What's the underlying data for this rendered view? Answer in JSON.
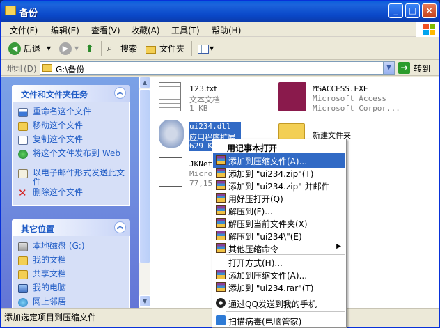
{
  "window": {
    "title": "备份"
  },
  "menu": [
    "文件(F)",
    "编辑(E)",
    "查看(V)",
    "收藏(A)",
    "工具(T)",
    "帮助(H)"
  ],
  "toolbar": {
    "back_label": "后退",
    "search_label": "搜索",
    "folders_label": "文件夹"
  },
  "address": {
    "label": "地址(D)",
    "value": "G:\\备份",
    "go_label": "转到"
  },
  "tasks_panel": {
    "title": "文件和文件夹任务",
    "items": [
      "重命名这个文件",
      "移动这个文件",
      "复制这个文件",
      "将这个文件发布到 Web",
      "以电子邮件形式发送此文件",
      "删除这个文件"
    ]
  },
  "places_panel": {
    "title": "其它位置",
    "items": [
      "本地磁盘 (G:)",
      "我的文档",
      "共享文档",
      "我的电脑",
      "网上邻居"
    ]
  },
  "files": [
    {
      "name": "123.txt",
      "line2": "文本文档",
      "line3": "1 KB"
    },
    {
      "name": "MSACCESS.EXE",
      "line2": "Microsoft Access",
      "line3": "Microsoft Corpor..."
    },
    {
      "name": "ui234.dll",
      "line2": "应用程序扩展",
      "line3": "629 KB"
    },
    {
      "name": "新建文件夹"
    },
    {
      "name": "JKNetL",
      "line2": "Micros",
      "line3": "77,158"
    }
  ],
  "context_menu": {
    "header": "用记事本打开",
    "items": [
      "添加到压缩文件(A)...",
      "添加到 \"ui234.zip\"(T)",
      "添加到 \"ui234.zip\" 并邮件",
      "用好压打开(Q)",
      "解压到(F)...",
      "解压到当前文件夹(X)",
      "解压到 \"ui234\\\"(E)",
      "其他压缩命令",
      "打开方式(H)...",
      "添加到压缩文件(A)...",
      "添加到 \"ui234.rar\"(T)",
      "通过QQ发送到我的手机",
      "扫描病毒(电脑管家)"
    ]
  },
  "status": {
    "text": "添加选定项目到压缩文件"
  },
  "colors": {
    "titlebar": "#0a48c8",
    "highlight": "#316ac5",
    "task_link": "#215dc6"
  }
}
